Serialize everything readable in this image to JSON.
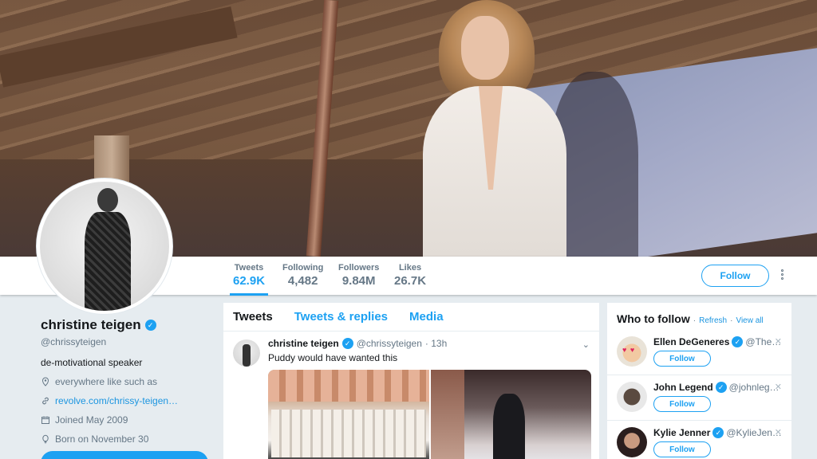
{
  "profile": {
    "name": "christine teigen",
    "handle": "@chrissyteigen",
    "bio": "de-motivational speaker",
    "location": "everywhere like such as",
    "website": "revolve.com/chrissy-teigen…",
    "joined": "Joined May 2009",
    "born": "Born on November 30"
  },
  "stats": [
    {
      "label": "Tweets",
      "value": "62.9K"
    },
    {
      "label": "Following",
      "value": "4,482"
    },
    {
      "label": "Followers",
      "value": "9.84M"
    },
    {
      "label": "Likes",
      "value": "26.7K"
    }
  ],
  "follow_label": "Follow",
  "timeline": {
    "tabs": [
      "Tweets",
      "Tweets & replies",
      "Media"
    ],
    "tweet": {
      "name": "christine teigen",
      "handle": "@chrissyteigen",
      "time": "· 13h",
      "text": "Puddy would have wanted this"
    }
  },
  "who_to_follow": {
    "title": "Who to follow",
    "refresh": "Refresh",
    "view_all": "View all",
    "separator": "·",
    "suggestions": [
      {
        "name": "Ellen DeGeneres",
        "handle": "@The…",
        "button": "Follow"
      },
      {
        "name": "John Legend",
        "handle": "@johnleg…",
        "button": "Follow"
      },
      {
        "name": "Kylie Jenner",
        "handle": "@KylieJen…",
        "button": "Follow"
      }
    ]
  },
  "colors": {
    "accent": "#1da1f2",
    "background": "#e6ecf0",
    "muted": "#657786"
  }
}
